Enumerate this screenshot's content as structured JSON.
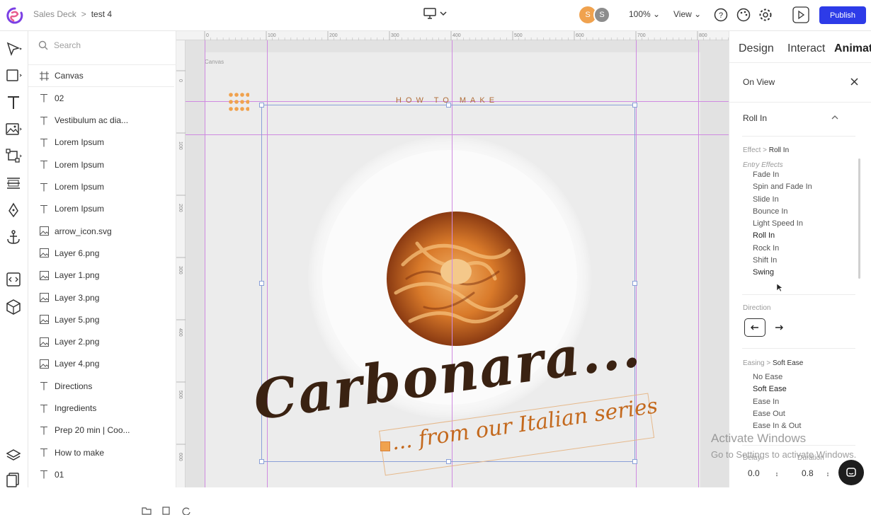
{
  "topbar": {
    "breadcrumb_project": "Sales Deck",
    "breadcrumb_sep": ">",
    "breadcrumb_page": "test 4",
    "avatar1_initial": "S",
    "avatar2_initial": "S",
    "zoom": "100%",
    "view_label": "View",
    "publish_label": "Publish"
  },
  "layers": {
    "search_placeholder": "Search",
    "items": [
      {
        "label": "Canvas",
        "icon": "artboard-icon"
      },
      {
        "label": "02",
        "icon": "text-icon"
      },
      {
        "label": "Vestibulum ac dia...",
        "icon": "text-icon"
      },
      {
        "label": "Lorem Ipsum",
        "icon": "text-icon"
      },
      {
        "label": "Lorem Ipsum",
        "icon": "text-icon"
      },
      {
        "label": "Lorem Ipsum",
        "icon": "text-icon"
      },
      {
        "label": "Lorem Ipsum",
        "icon": "text-icon"
      },
      {
        "label": "arrow_icon.svg",
        "icon": "image-icon"
      },
      {
        "label": "Layer 6.png",
        "icon": "image-icon"
      },
      {
        "label": "Layer 1.png",
        "icon": "image-icon"
      },
      {
        "label": "Layer 3.png",
        "icon": "image-icon"
      },
      {
        "label": "Layer 5.png",
        "icon": "image-icon"
      },
      {
        "label": "Layer 2.png",
        "icon": "image-icon"
      },
      {
        "label": "Layer 4.png",
        "icon": "image-icon"
      },
      {
        "label": "Directions",
        "icon": "text-icon"
      },
      {
        "label": "Ingredients",
        "icon": "text-icon"
      },
      {
        "label": "Prep 20 min | Coo...",
        "icon": "text-icon"
      },
      {
        "label": "How to make",
        "icon": "text-icon"
      },
      {
        "label": "01",
        "icon": "text-icon"
      }
    ]
  },
  "canvas": {
    "ruler_labels": [
      "0",
      "100",
      "200",
      "300",
      "400",
      "500",
      "600",
      "700",
      "800"
    ],
    "vruler_labels": [
      "0",
      "100",
      "200",
      "300",
      "400",
      "500",
      "600"
    ],
    "canvas_label": "Canvas",
    "how_to_make": "HOW TO MAKE",
    "title": "Carbonara...",
    "tagline": "... from our Italian series"
  },
  "panel": {
    "tabs": [
      "Design",
      "Interact",
      "Animate"
    ],
    "on_view": "On View",
    "roll_in_header": "Roll In",
    "effect_label": "Effect",
    "effect_value": "Roll In",
    "entry_effects_label": "Entry Effects",
    "effects": [
      "Fade In",
      "Spin and Fade In",
      "Slide In",
      "Bounce In",
      "Light Speed In",
      "Roll In",
      "Rock In",
      "Shift In",
      "Swing"
    ],
    "direction_label": "Direction",
    "easing_label": "Easing",
    "easing_value": "Soft Ease",
    "easings": [
      "No Ease",
      "Soft Ease",
      "Ease In",
      "Ease Out",
      "Ease In & Out"
    ],
    "delay_label": "Delay",
    "duration_label": "Duration",
    "delay_value": "0.0",
    "duration_value": "0.8"
  },
  "watermark": {
    "line1": "Activate Windows",
    "line2": "Go to Settings to activate Windows."
  },
  "colors": {
    "accent": "#2d3be8",
    "guide": "#cf8ae0",
    "title_brown": "#3a2212",
    "tag_orange": "#c4691d"
  }
}
